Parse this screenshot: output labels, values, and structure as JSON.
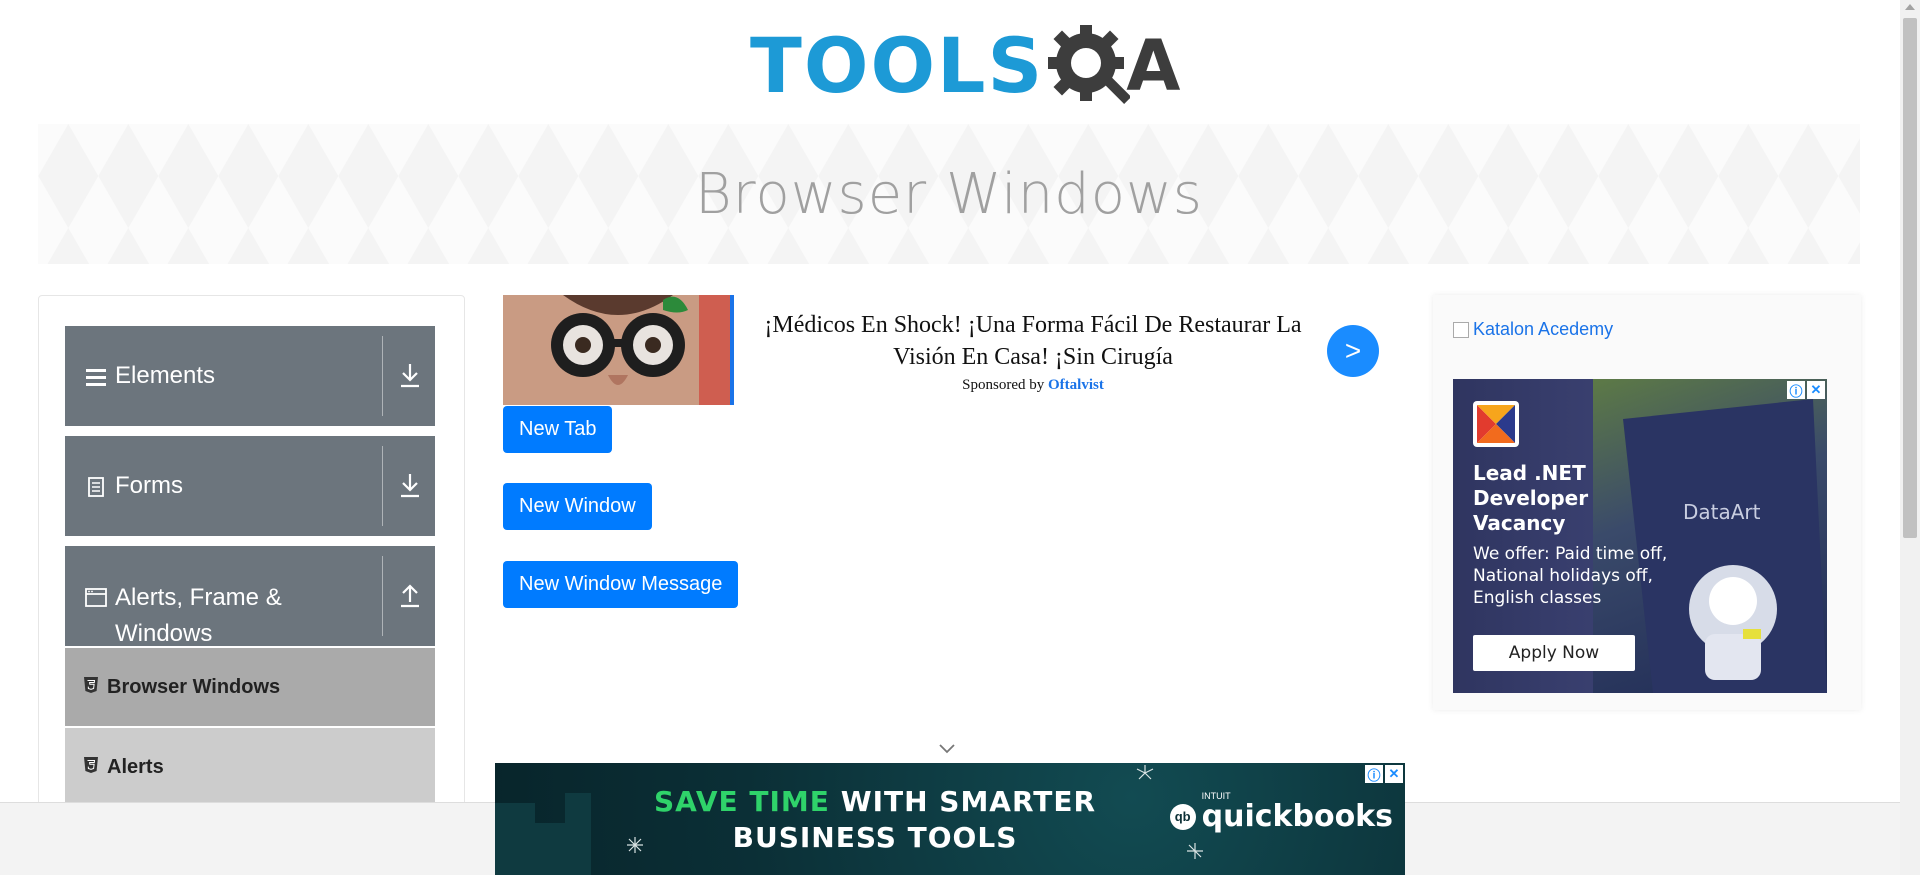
{
  "logo": {
    "tools": "TOOLS",
    "qa": "QA"
  },
  "banner": {
    "title": "Browser Windows"
  },
  "sidebar": {
    "groups": [
      {
        "label": "Elements",
        "icon": "list-icon",
        "state": "collapsed"
      },
      {
        "label": "Forms",
        "icon": "document-icon",
        "state": "collapsed"
      },
      {
        "label": "Alerts, Frame & Windows",
        "label_line1": "Alerts, Frame &",
        "label_line2": "Windows",
        "icon": "window-icon",
        "state": "expanded"
      }
    ],
    "items": [
      {
        "label": "Browser Windows",
        "active": true
      },
      {
        "label": "Alerts",
        "active": false
      }
    ]
  },
  "ad_top": {
    "headline": "¡Médicos En Shock! ¡Una Forma Fácil De Restaurar La Visión En Casa! ¡Sin Cirugía",
    "sponsored_prefix": "Sponsored by",
    "sponsor": "Oftalvist",
    "go_symbol": ">"
  },
  "buttons": {
    "new_tab": "New Tab",
    "new_window": "New Window",
    "new_window_message": "New Window Message"
  },
  "ad_right": {
    "link_text": "Katalon Acedemy",
    "title": "Lead .NET Developer Vacancy",
    "body": "We offer: Paid time off, National holidays off, English classes",
    "cta": "Apply Now",
    "brand": "DataArt"
  },
  "ad_bottom": {
    "line1_green": "SAVE TIME",
    "line1_white": "WITH SMARTER",
    "line2": "BUSINESS TOOLS",
    "brand_small": "INTUIT",
    "brand": "quickbooks",
    "brand_mark": "qb"
  },
  "colors": {
    "primary": "#007bff",
    "sidebar_group": "#6c757d",
    "active_item": "#aaaaaa",
    "item": "#cccccc",
    "logo_blue": "#1d9ad6"
  }
}
